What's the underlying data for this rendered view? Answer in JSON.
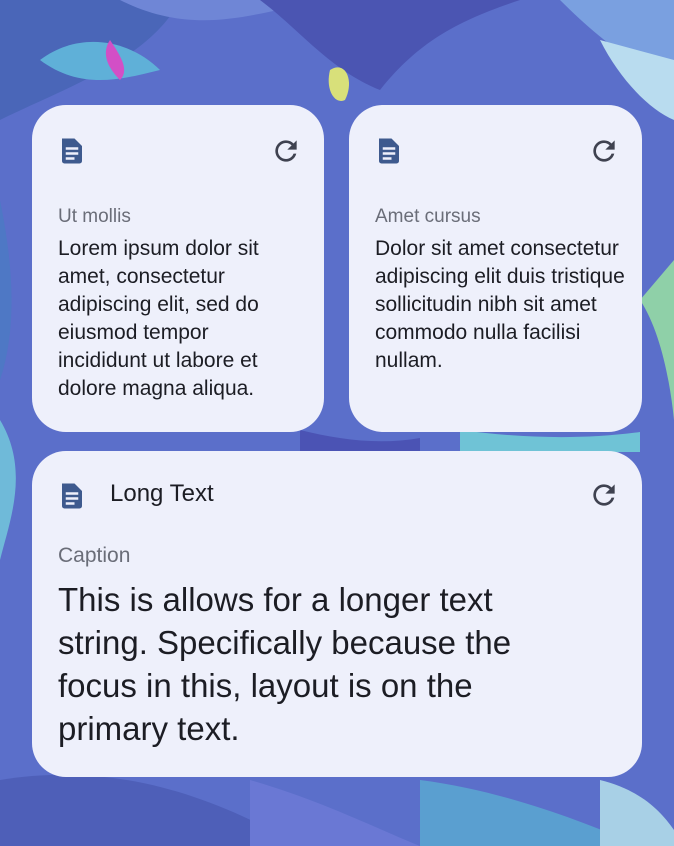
{
  "colors": {
    "card_bg": "#eef0fb",
    "icon": "#3e5a8e",
    "text": "#1c1d24",
    "caption": "#6a6d78"
  },
  "widgets": [
    {
      "icon": "document-icon",
      "action_icon": "refresh-icon",
      "caption": "Ut mollis",
      "body": "Lorem ipsum dolor sit amet, consectetur adipiscing elit, sed do eiusmod tempor incididunt ut labore et dolore magna aliqua."
    },
    {
      "icon": "document-icon",
      "action_icon": "refresh-icon",
      "caption": "Amet cursus",
      "body": "Dolor sit amet consectetur adipiscing elit duis tristique sollicitudin nibh sit amet commodo nulla facilisi nullam."
    }
  ],
  "long_widget": {
    "icon": "document-icon",
    "action_icon": "refresh-icon",
    "title": "Long Text",
    "caption": "Caption",
    "primary": "This is allows for a longer text string. Specifically because the focus in this, layout is on the primary text."
  }
}
